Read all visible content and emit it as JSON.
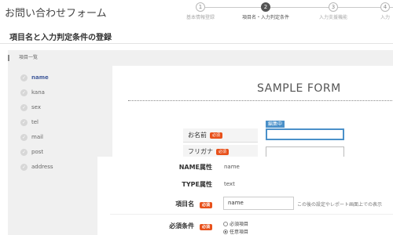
{
  "app": {
    "title": "お問い合わせフォーム"
  },
  "steps": [
    {
      "num": "1",
      "label": "基本情報登録",
      "active": false
    },
    {
      "num": "2",
      "label": "項目名・入力判定条件",
      "active": true
    },
    {
      "num": "3",
      "label": "入力支援機能",
      "active": false
    },
    {
      "num": "4",
      "label": "入力",
      "active": false
    }
  ],
  "section": {
    "title": "項目名と入力判定条件の登録"
  },
  "sidebar": {
    "header": "項目一覧",
    "items": [
      {
        "name": "name",
        "selected": true
      },
      {
        "name": "kana",
        "selected": false
      },
      {
        "name": "sex",
        "selected": false
      },
      {
        "name": "tel",
        "selected": false
      },
      {
        "name": "mail",
        "selected": false
      },
      {
        "name": "post",
        "selected": false
      },
      {
        "name": "address",
        "selected": false
      }
    ],
    "check_glyph": "✓"
  },
  "preview": {
    "form_title": "SAMPLE FORM",
    "rows": [
      {
        "label": "お名前",
        "badge": "必須"
      },
      {
        "label": "フリガナ",
        "badge": "必須"
      }
    ],
    "editing_badge": "編集中"
  },
  "attributes": {
    "name_attr_label": "NAME属性",
    "name_attr_value": "name",
    "type_attr_label": "TYPE属性",
    "type_attr_value": "text",
    "item_name_label": "項目名",
    "item_name_badge": "必須",
    "item_name_value": "name",
    "item_name_hint": "この後の設定やレポート画面上での表示",
    "required_label": "必須条件",
    "required_badge": "必須",
    "required_options": [
      {
        "label": "必須項目",
        "checked": false
      },
      {
        "label": "任意項目",
        "checked": true
      }
    ]
  },
  "colors": {
    "accent": "#4a90c9",
    "badge": "#e8511b",
    "selected_text": "#445d9c"
  }
}
